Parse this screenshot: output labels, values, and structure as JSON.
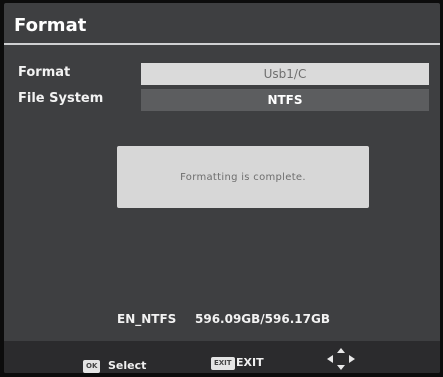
{
  "header": {
    "title": "Format"
  },
  "form": {
    "format_label": "Format",
    "format_value": "Usb1/C",
    "filesystem_label": "File System",
    "filesystem_value": "NTFS"
  },
  "dialog": {
    "message": "Formatting is complete."
  },
  "storage": {
    "volume": "EN_NTFS",
    "usage": "596.09GB/596.17GB"
  },
  "footer": {
    "ok_key": "OK",
    "ok_label": "Select",
    "exit_key": "EXIT",
    "exit_label": "EXIT"
  },
  "colors": {
    "panel_bg": "#3e3f41",
    "highlight_row": "#dadada",
    "dialog_bg": "#d7d7d7",
    "footer_bg": "#2b2b2d"
  }
}
